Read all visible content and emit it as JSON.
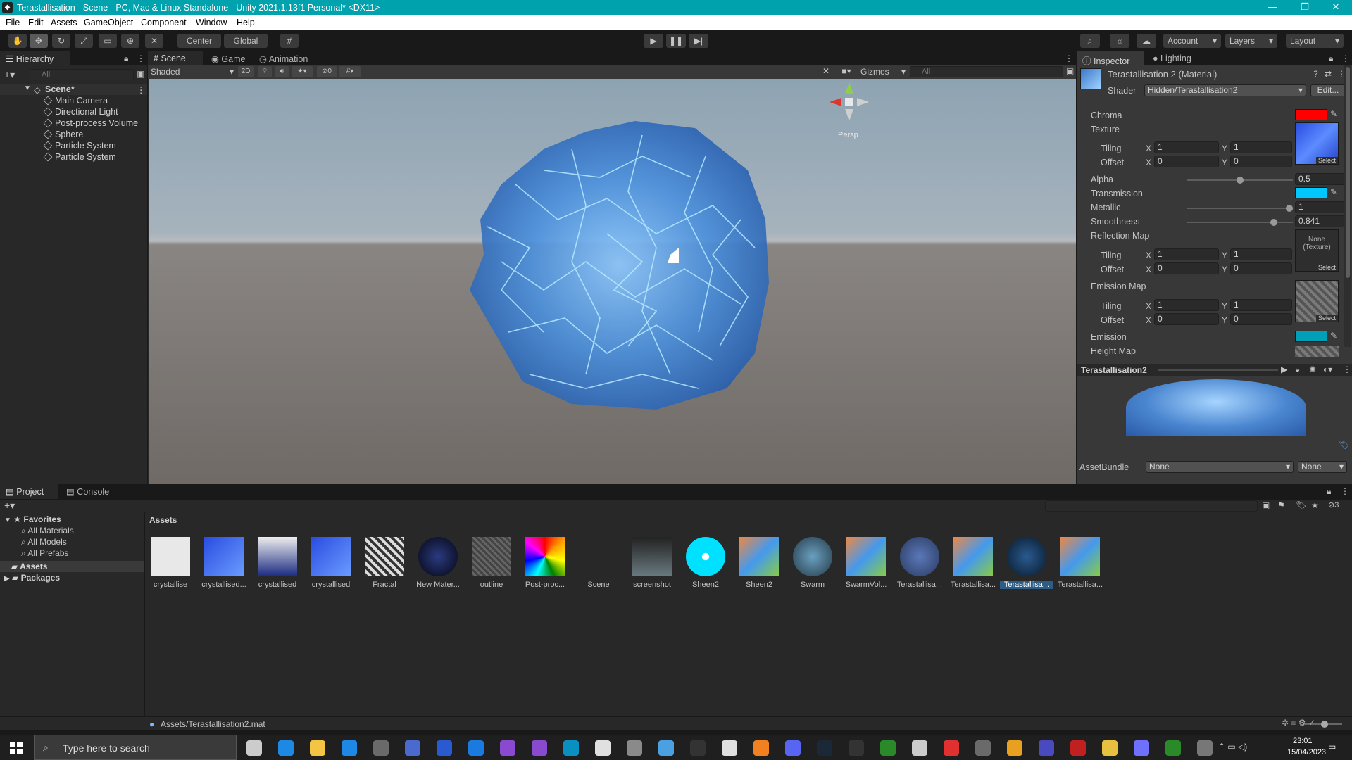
{
  "window": {
    "title": "Terastallisation - Scene - PC, Mac & Linux Standalone - Unity 2021.1.13f1 Personal* <DX11>"
  },
  "menu": [
    "File",
    "Edit",
    "Assets",
    "GameObject",
    "Component",
    "Window",
    "Help"
  ],
  "toolbar": {
    "center": "Center",
    "global": "Global",
    "account": "Account",
    "layers": "Layers",
    "layout": "Layout"
  },
  "hierarchy": {
    "tab": "Hierarchy",
    "search_placeholder": "All",
    "scene": "Scene*",
    "items": [
      "Main Camera",
      "Directional Light",
      "Post-process Volume",
      "Sphere",
      "Particle System",
      "Particle System"
    ]
  },
  "scene_view": {
    "tabs": [
      "Scene",
      "Game",
      "Animation"
    ],
    "shading": "Shaded",
    "mode_2d": "2D",
    "hidden_count": "0",
    "gizmos": "Gizmos",
    "search_placeholder": "All",
    "persp": "Persp"
  },
  "inspector": {
    "tabs": [
      "Inspector",
      "Lighting"
    ],
    "material_title": "Terastallisation 2 (Material)",
    "shader_label": "Shader",
    "shader_value": "Hidden/Terastallisation2",
    "edit": "Edit...",
    "chroma": "Chroma",
    "chroma_color": "#ff0000",
    "texture": "Texture",
    "tiling": "Tiling",
    "offset": "Offset",
    "x": "X",
    "y": "Y",
    "tex_tiling": [
      "1",
      "1"
    ],
    "tex_offset": [
      "0",
      "0"
    ],
    "alpha": "Alpha",
    "alpha_value": "0.5",
    "alpha_level": 0.5,
    "transmission": "Transmission",
    "transmission_color": "#00c8ff",
    "metallic": "Metallic",
    "metallic_value": "1",
    "metallic_level": 1,
    "smoothness": "Smoothness",
    "smoothness_value": "0.841",
    "smoothness_level": 0.841,
    "reflection_map": "Reflection Map",
    "none_texture": "None (Texture)",
    "refl_tiling": [
      "1",
      "1"
    ],
    "refl_offset": [
      "0",
      "0"
    ],
    "emission_map": "Emission Map",
    "em_tiling": [
      "1",
      "1"
    ],
    "em_offset": [
      "0",
      "0"
    ],
    "emission": "Emission",
    "emission_color": "#00a0b8",
    "height_map": "Height Map",
    "select": "Select",
    "preview_title": "Terastallisation2",
    "assetbundle": "AssetBundle",
    "assetbundle_value": "None",
    "assetbundle_variant": "None"
  },
  "project": {
    "tabs": [
      "Project",
      "Console"
    ],
    "favorites": "Favorites",
    "fav_items": [
      "All Materials",
      "All Models",
      "All Prefabs"
    ],
    "assets_root": "Assets",
    "packages": "Packages",
    "breadcrumb": "Assets",
    "hidden_count": "3",
    "asset_items": [
      "crystallise",
      "crystallised...",
      "crystallised",
      "crystallised",
      "Fractal",
      "New Mater...",
      "outline",
      "Post-proc...",
      "Scene",
      "screenshot",
      "Sheen2",
      "Sheen2",
      "Swarm",
      "SwarmVol...",
      "Terastallisa...",
      "Terastallisa...",
      "Terastallisa...",
      "Terastallisa..."
    ],
    "selected_path": "Assets/Terastallisation2.mat"
  },
  "taskbar": {
    "search_placeholder": "Type here to search",
    "time": "23:01",
    "date": "15/04/2023"
  }
}
